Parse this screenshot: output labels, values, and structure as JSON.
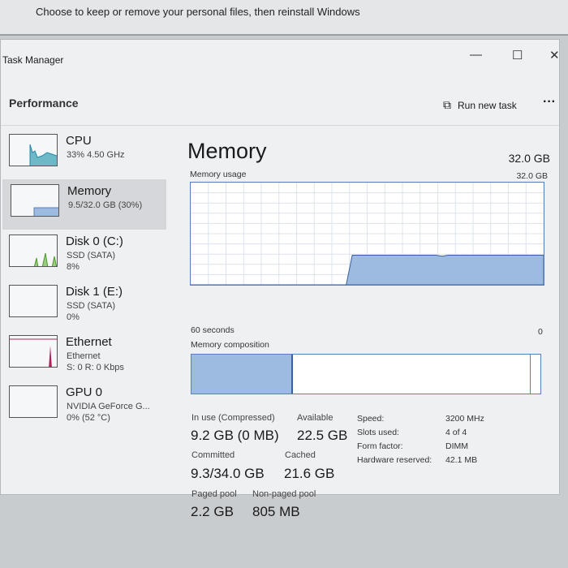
{
  "background_text": "Choose to keep or remove your personal files, then reinstall Windows",
  "window": {
    "title": "Task Manager",
    "minimize": "—",
    "maximize": "☐",
    "close": "✕"
  },
  "header": {
    "title": "Performance",
    "run_new_task": "Run new task",
    "more": "···"
  },
  "sidebar": [
    {
      "name": "CPU",
      "line1": "33% 4.50 GHz",
      "line2": ""
    },
    {
      "name": "Memory",
      "line1": "9.5/32.0 GB (30%)",
      "line2": ""
    },
    {
      "name": "Disk 0 (C:)",
      "line1": "SSD (SATA)",
      "line2": "8%"
    },
    {
      "name": "Disk 1 (E:)",
      "line1": "SSD (SATA)",
      "line2": "0%"
    },
    {
      "name": "Ethernet",
      "line1": "Ethernet",
      "line2": "S: 0 R: 0 Kbps"
    },
    {
      "name": "GPU 0",
      "line1": "NVIDIA GeForce G...",
      "line2": "0% (52 °C)"
    }
  ],
  "main": {
    "title": "Memory",
    "total": "32.0 GB",
    "usage_label": "Memory usage",
    "usage_max": "32.0 GB",
    "time_left": "60 seconds",
    "time_right": "0",
    "composition_label": "Memory composition",
    "usage_history_percent": [
      0,
      0,
      0,
      0,
      0,
      0,
      0,
      0,
      0,
      0,
      0,
      0,
      0,
      0,
      0,
      0,
      0,
      0,
      0,
      0,
      0,
      0,
      0,
      0,
      0,
      0,
      0,
      29,
      29,
      29,
      29,
      29,
      29,
      29,
      29,
      29,
      29,
      29,
      29,
      29,
      29,
      29,
      28,
      29,
      29,
      29,
      29,
      29,
      29,
      29,
      29,
      29,
      29,
      29,
      29,
      29,
      29,
      29,
      29,
      29
    ],
    "composition_in_use_fraction": 0.29,
    "stats": {
      "in_use_label": "In use (Compressed)",
      "in_use": "9.2 GB (0 MB)",
      "available_label": "Available",
      "available": "22.5 GB",
      "committed_label": "Committed",
      "committed": "9.3/34.0 GB",
      "cached_label": "Cached",
      "cached": "21.6 GB",
      "paged_label": "Paged pool",
      "paged": "2.2 GB",
      "nonpaged_label": "Non-paged pool",
      "nonpaged": "805 MB"
    },
    "specs": [
      {
        "k": "Speed:",
        "v": "3200 MHz"
      },
      {
        "k": "Slots used:",
        "v": "4 of 4"
      },
      {
        "k": "Form factor:",
        "v": "DIMM"
      },
      {
        "k": "Hardware reserved:",
        "v": "42.1 MB"
      }
    ]
  },
  "colors": {
    "memory": "#5b7fb8",
    "memory_fill": "#9dbbe0",
    "cpu": "#1e8aa8",
    "disk": "#4a9a2a",
    "ethernet": "#b0205a",
    "gpu": "#4040b0"
  }
}
